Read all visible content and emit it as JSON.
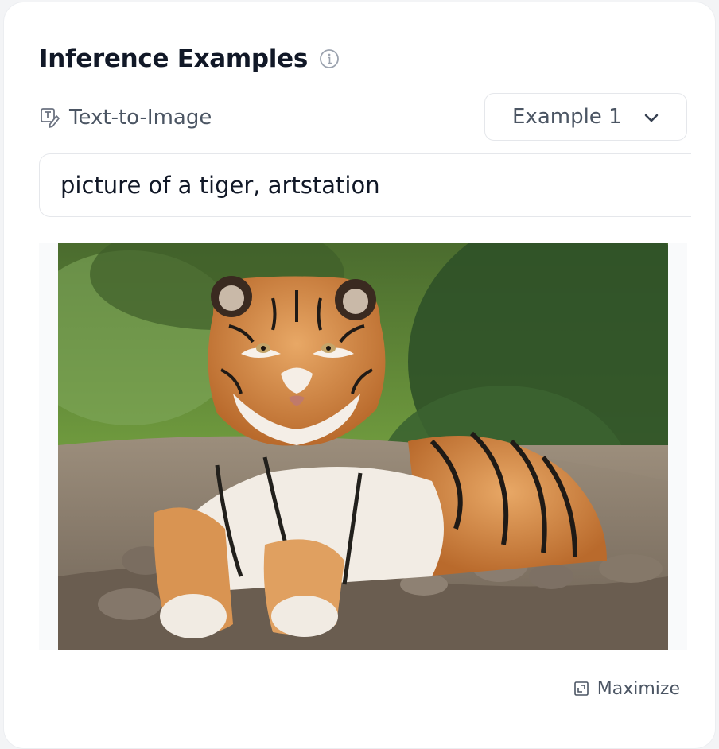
{
  "widget": {
    "title": "Inference Examples",
    "task_label": "Text-to-Image",
    "example_select": {
      "value": "Example 1"
    },
    "prompt": "picture of a tiger, artstation",
    "maximize_label": "Maximize"
  },
  "icons": {
    "info": "info-circle-icon",
    "task": "text-to-image-icon",
    "select": "chevron-down-icon",
    "maximize": "maximize-icon"
  },
  "colors": {
    "title": "#111827",
    "muted_text": "#4b5563",
    "border": "#e5e7eb"
  }
}
